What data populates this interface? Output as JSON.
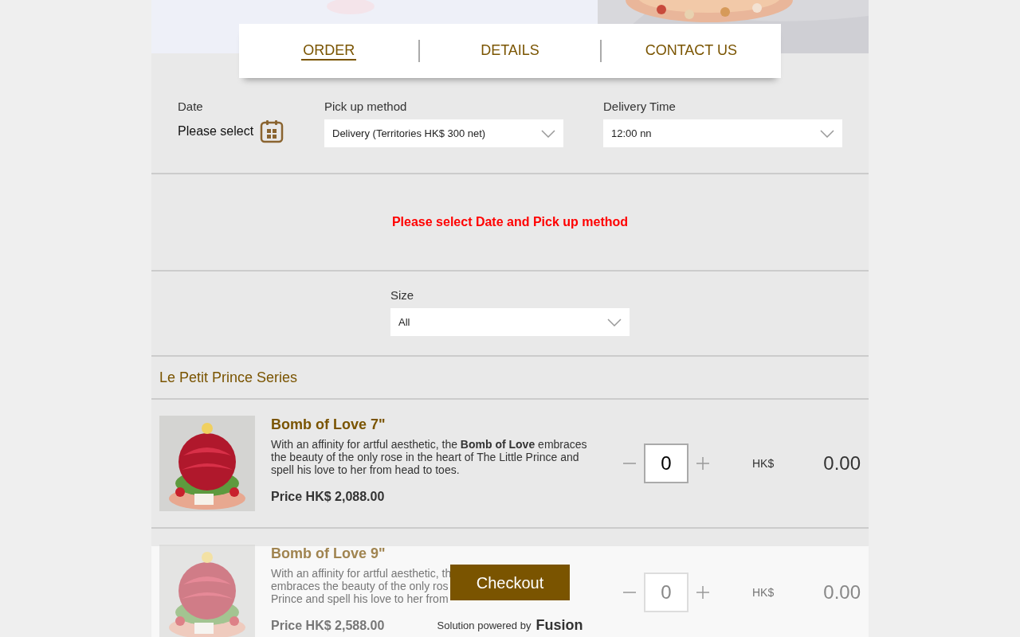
{
  "tabs": [
    {
      "label": "ORDER",
      "selected": true
    },
    {
      "label": "DETAILS",
      "selected": false
    },
    {
      "label": "CONTACT US",
      "selected": false
    }
  ],
  "filters": {
    "date": {
      "label": "Date",
      "value": "Please select"
    },
    "pickup": {
      "label": "Pick up method",
      "value": "Delivery (Territories HK$ 300 net)"
    },
    "delivery_time": {
      "label": "Delivery Time",
      "value": "12:00 nn"
    }
  },
  "notice": "Please select Date and Pick up method",
  "size": {
    "label": "Size",
    "value": "All"
  },
  "series_title": "Le Petit Prince Series",
  "products": [
    {
      "name": "Bomb of Love 7\"",
      "description": "With an affinity for artful aesthetic, the **Bomb of Love** embraces the beauty of the only rose in the heart of The Little Prince and spell his love to her from head to toes.",
      "price": "Price HK$ 2,088.00",
      "quantity": "0",
      "currency": "HK$",
      "total": "0.00"
    },
    {
      "name": "Bomb of Love 9\"",
      "description_lines": [
        "With an affinity for artful aesthetic, th",
        "embraces the beauty of the only ros",
        "Prince and spell his love to her from"
      ],
      "price": "Price HK$ 2,588.00",
      "quantity": "0",
      "currency": "HK$",
      "total": "0.00"
    }
  ],
  "footer": {
    "checkout": "Checkout",
    "powered_by": "Solution powered by",
    "brand": "Fusion"
  }
}
